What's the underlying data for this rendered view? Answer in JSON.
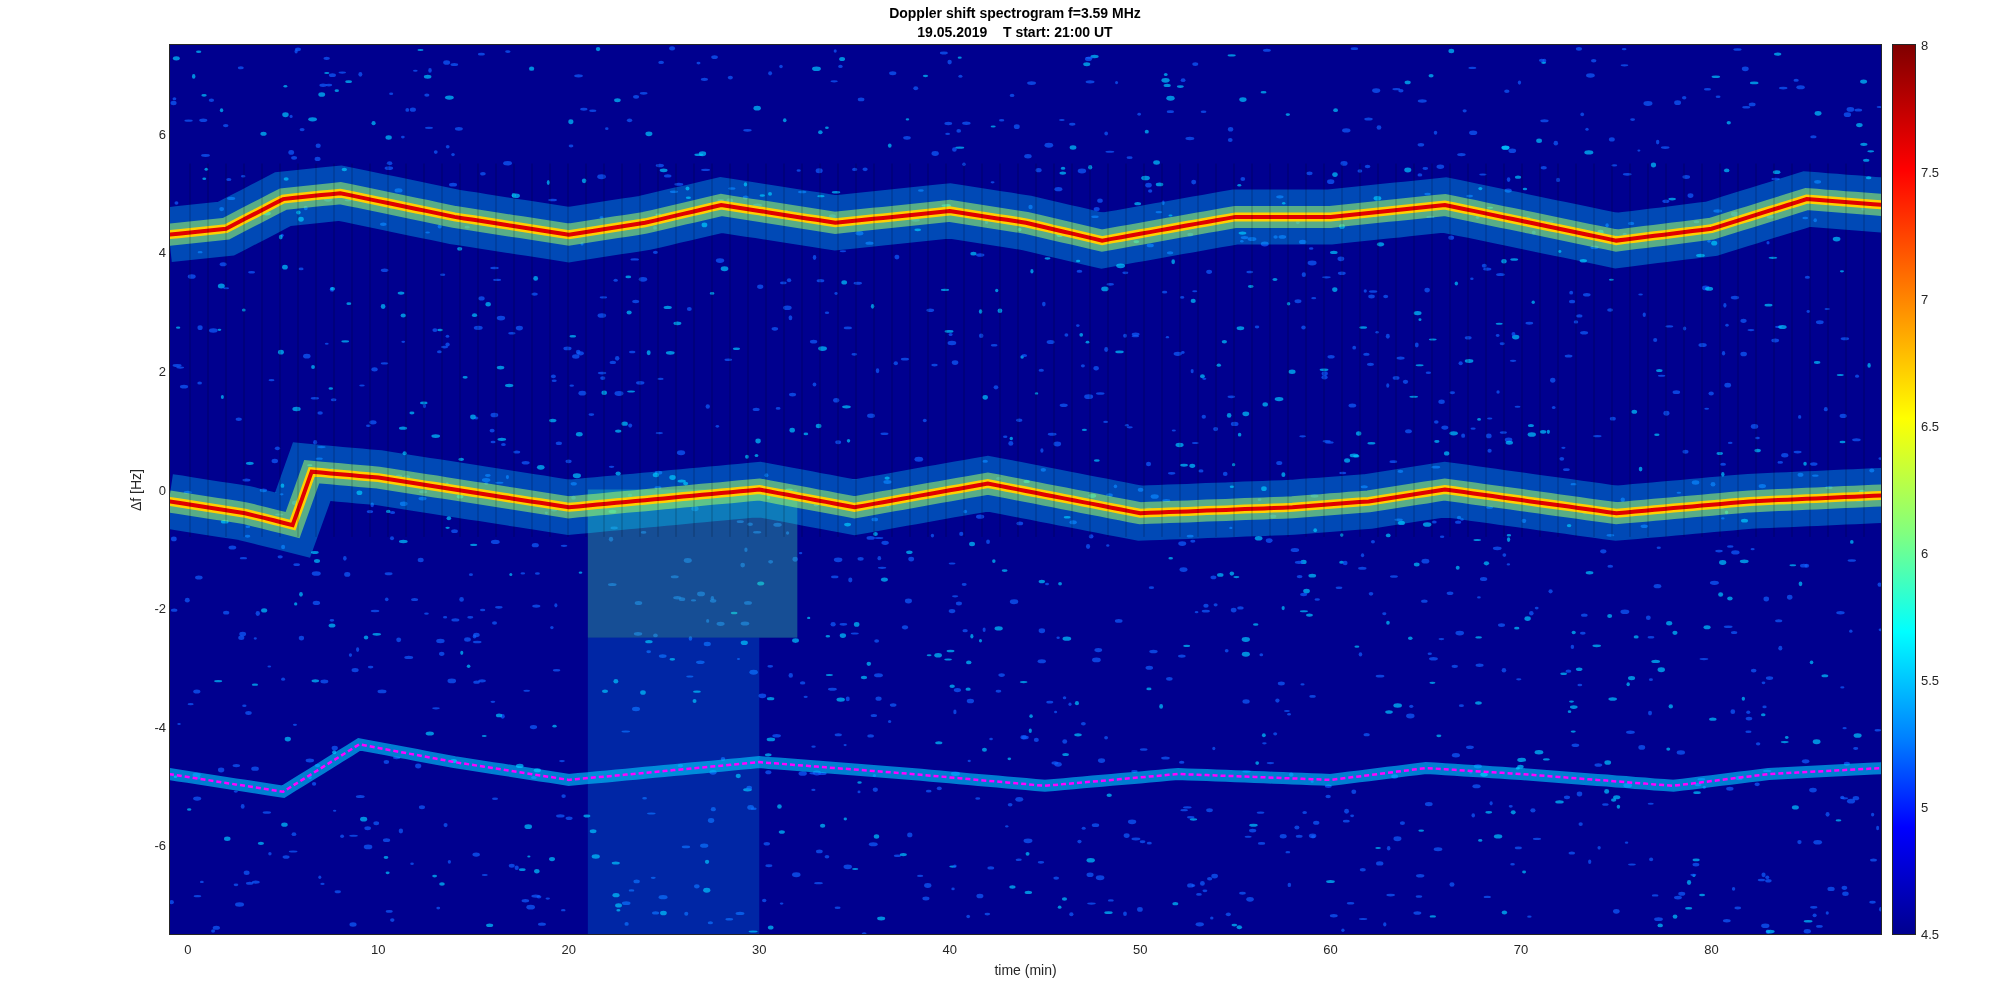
{
  "figure": {
    "title": "Doppler shift spectrogram f=3.59 MHz",
    "subtitle": "19.05.2019    T start: 21:00 UT"
  },
  "axes": {
    "xlabel": "time (min)",
    "ylabel": "Δf [Hz]",
    "xticks": [
      "0",
      "10",
      "20",
      "30",
      "40",
      "50",
      "60",
      "70",
      "80"
    ],
    "yticks": [
      "6",
      "4",
      "2",
      "0",
      "-2",
      "-4",
      "-6"
    ]
  },
  "colorbar": {
    "ticks": [
      "8",
      "7.5",
      "7",
      "6.5",
      "6",
      "5.5",
      "5",
      "4.5"
    ]
  }
}
